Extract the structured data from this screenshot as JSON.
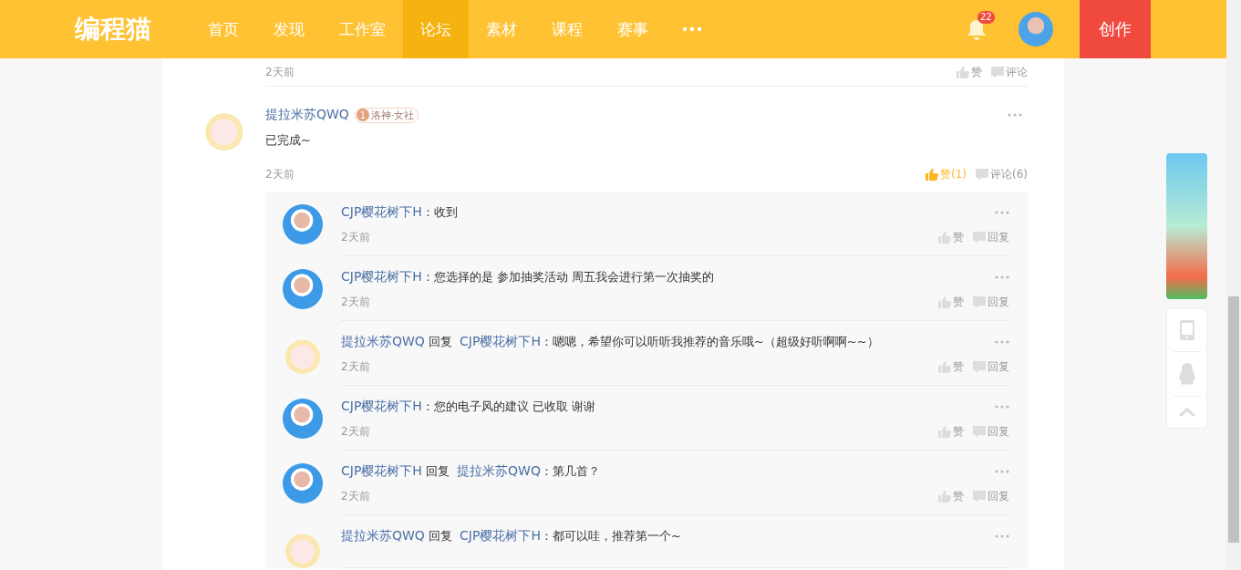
{
  "header": {
    "logo": "编程猫",
    "nav": [
      {
        "label": "首页",
        "selected": false
      },
      {
        "label": "发现",
        "selected": false
      },
      {
        "label": "工作室",
        "selected": false
      },
      {
        "label": "论坛",
        "selected": true
      },
      {
        "label": "素材",
        "selected": false
      },
      {
        "label": "课程",
        "selected": false
      },
      {
        "label": "赛事",
        "selected": false
      }
    ],
    "notification_count": "22",
    "create_button": "创作"
  },
  "previous_comment": {
    "time": "2天前",
    "like": "赞",
    "comment": "评论"
  },
  "comment": {
    "kind": "bunny",
    "author": "提拉米苏QWQ",
    "badge": {
      "level": "1",
      "label": "洛神·女社"
    },
    "text": "已完成~",
    "time": "2天前",
    "like": {
      "label": "赞(1)",
      "liked": true
    },
    "comment_label": "评论(6)",
    "replies": [
      {
        "kind": "girl",
        "author": "CJP樱花树下H",
        "text": "：收到",
        "time": "2天前",
        "like": "赞",
        "reply": "回复"
      },
      {
        "kind": "girl",
        "author": "CJP樱花树下H",
        "text": "：您选择的是 参加抽奖活动 周五我会进行第一次抽奖的",
        "time": "2天前",
        "like": "赞",
        "reply": "回复"
      },
      {
        "kind": "bunny",
        "author": "提拉米苏QWQ",
        "reply_word": "回复",
        "reply_to": "CJP樱花树下H",
        "text": "：嗯嗯，希望你可以听听我推荐的音乐哦~（超级好听啊啊~~）",
        "time": "2天前",
        "like": "赞",
        "reply": "回复"
      },
      {
        "kind": "girl",
        "author": "CJP樱花树下H",
        "text": "：您的电子风的建议 已收取 谢谢",
        "time": "2天前",
        "like": "赞",
        "reply": "回复"
      },
      {
        "kind": "girl",
        "author": "CJP樱花树下H",
        "reply_word": "回复",
        "reply_to": "提拉米苏QWQ",
        "text": "：第几首？",
        "time": "2天前",
        "like": "赞",
        "reply": "回复"
      },
      {
        "kind": "bunny",
        "author": "提拉米苏QWQ",
        "reply_word": "回复",
        "reply_to": "CJP樱花树下H",
        "text": "：都可以哇，推荐第一个~"
      }
    ]
  }
}
